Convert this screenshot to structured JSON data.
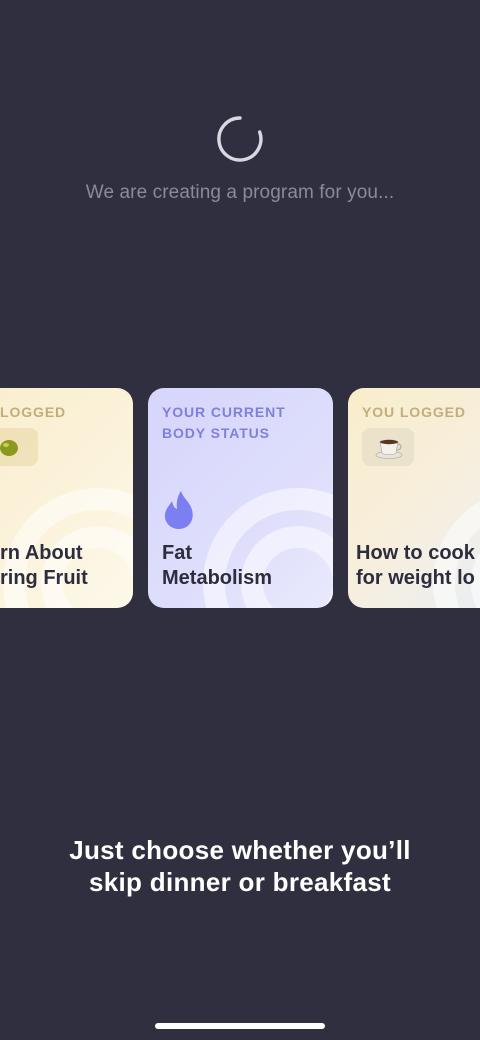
{
  "loading": {
    "text": "We are creating a program for you...",
    "spinner_icon": "loading-spinner-icon"
  },
  "cards": [
    {
      "label": "LOGGED",
      "icon": "olive-icon",
      "title_line1": "rn About",
      "title_line2": "ring Fruit"
    },
    {
      "label_line1": "YOUR CURRENT",
      "label_line2": "BODY STATUS",
      "icon": "flame-icon",
      "title_line1": "Fat",
      "title_line2": "Metabolism"
    },
    {
      "label": "YOU LOGGED",
      "icon": "coffee-cup-icon",
      "title_line1": "How to cook",
      "title_line2": "for weight lo"
    }
  ],
  "caption": {
    "line1": "Just choose whether you’ll",
    "line2": "skip dinner or breakfast"
  },
  "colors": {
    "background": "#302f3f",
    "accent_purple": "#7f80dc",
    "card_yellow": "#f9edcb",
    "card_purple": "#d6d5fb"
  }
}
